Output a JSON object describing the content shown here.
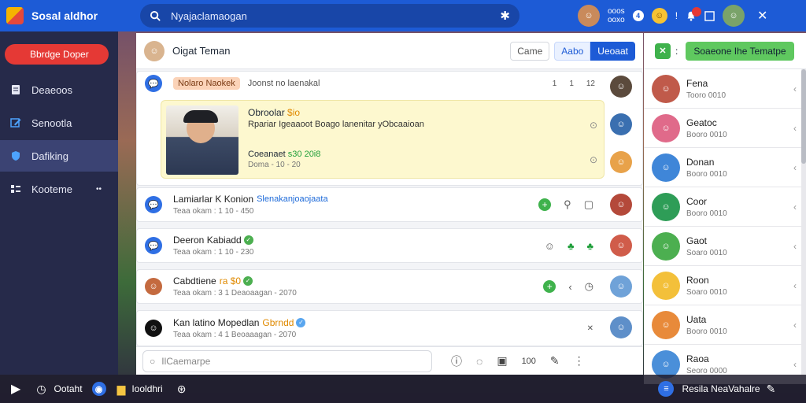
{
  "app": {
    "title": "Sosal aldhor"
  },
  "search": {
    "text": "Nyajaclamaogan"
  },
  "top_right": {
    "line1": "ooos",
    "line2": "ooxo",
    "notif_badge": "4"
  },
  "sidebar": {
    "primary_button": "Bbrdge Doper",
    "items": [
      {
        "label": "Deaeoos",
        "icon": "doc-icon"
      },
      {
        "label": "Senootla",
        "icon": "edit-icon"
      },
      {
        "label": "Dafiking",
        "icon": "shield-icon"
      },
      {
        "label": "Kooteme",
        "icon": "grid-icon",
        "more": "••"
      }
    ]
  },
  "main": {
    "header": {
      "name": "Oigat Teman",
      "btn1": "Came",
      "seg1": "Aabo",
      "seg2": "Ueoaat"
    },
    "first_post": {
      "tag": "Nolaro Naokek",
      "text": "Joonst no laenakal",
      "meta1": "1",
      "meta2": "1",
      "meta3": "12",
      "featured": {
        "title": "Obroolar",
        "title_highlight": "$io",
        "body": "Rpariar Igeaaoot Boago lanenitar yObcaaioan",
        "stat": "Coeanaet",
        "stat_value": "s30 20i8",
        "stat_sub": "Doma - 10 - 20"
      }
    },
    "rows": [
      {
        "title": "Lamiarlar K Konion",
        "link": "Slenakanjoaojaata",
        "sub": "Teaa okam : 1 10 - 450"
      },
      {
        "title": "Deeron Kabiadd",
        "sub": "Teaa okam : 1 10 - 230"
      },
      {
        "title": "Cabdtiene",
        "highlight": "ra $0",
        "sub": "Teaa okam : 3 1 Deaoaagan - 2070"
      },
      {
        "title": "Kan latino Mopedlan",
        "highlight": "Gbrndd",
        "sub": "Teaa okam : 4 1 Beoaaagan - 2070"
      }
    ],
    "composer": {
      "placeholder": "IlCaemarpe",
      "counter": "100"
    }
  },
  "right_panel": {
    "button": "Soaeone Ihe Tematpe",
    "contacts": [
      {
        "name": "Fena",
        "status": "Tooro 0010"
      },
      {
        "name": "Geatoc",
        "status": "Booro 0010"
      },
      {
        "name": "Donan",
        "status": "Booro 0010"
      },
      {
        "name": "Coor",
        "status": "Booro 0010"
      },
      {
        "name": "Gaot",
        "status": "Soaro 0010"
      },
      {
        "name": "Roon",
        "status": "Soaro 0010"
      },
      {
        "name": "Uata",
        "status": "Booro 0010"
      },
      {
        "name": "Raoa",
        "status": "Seoro 0000"
      }
    ]
  },
  "taskbar": {
    "left_text": "Ootaht",
    "mid_text": "Iooldhri",
    "right_text": "Resila NeaVahalre"
  }
}
